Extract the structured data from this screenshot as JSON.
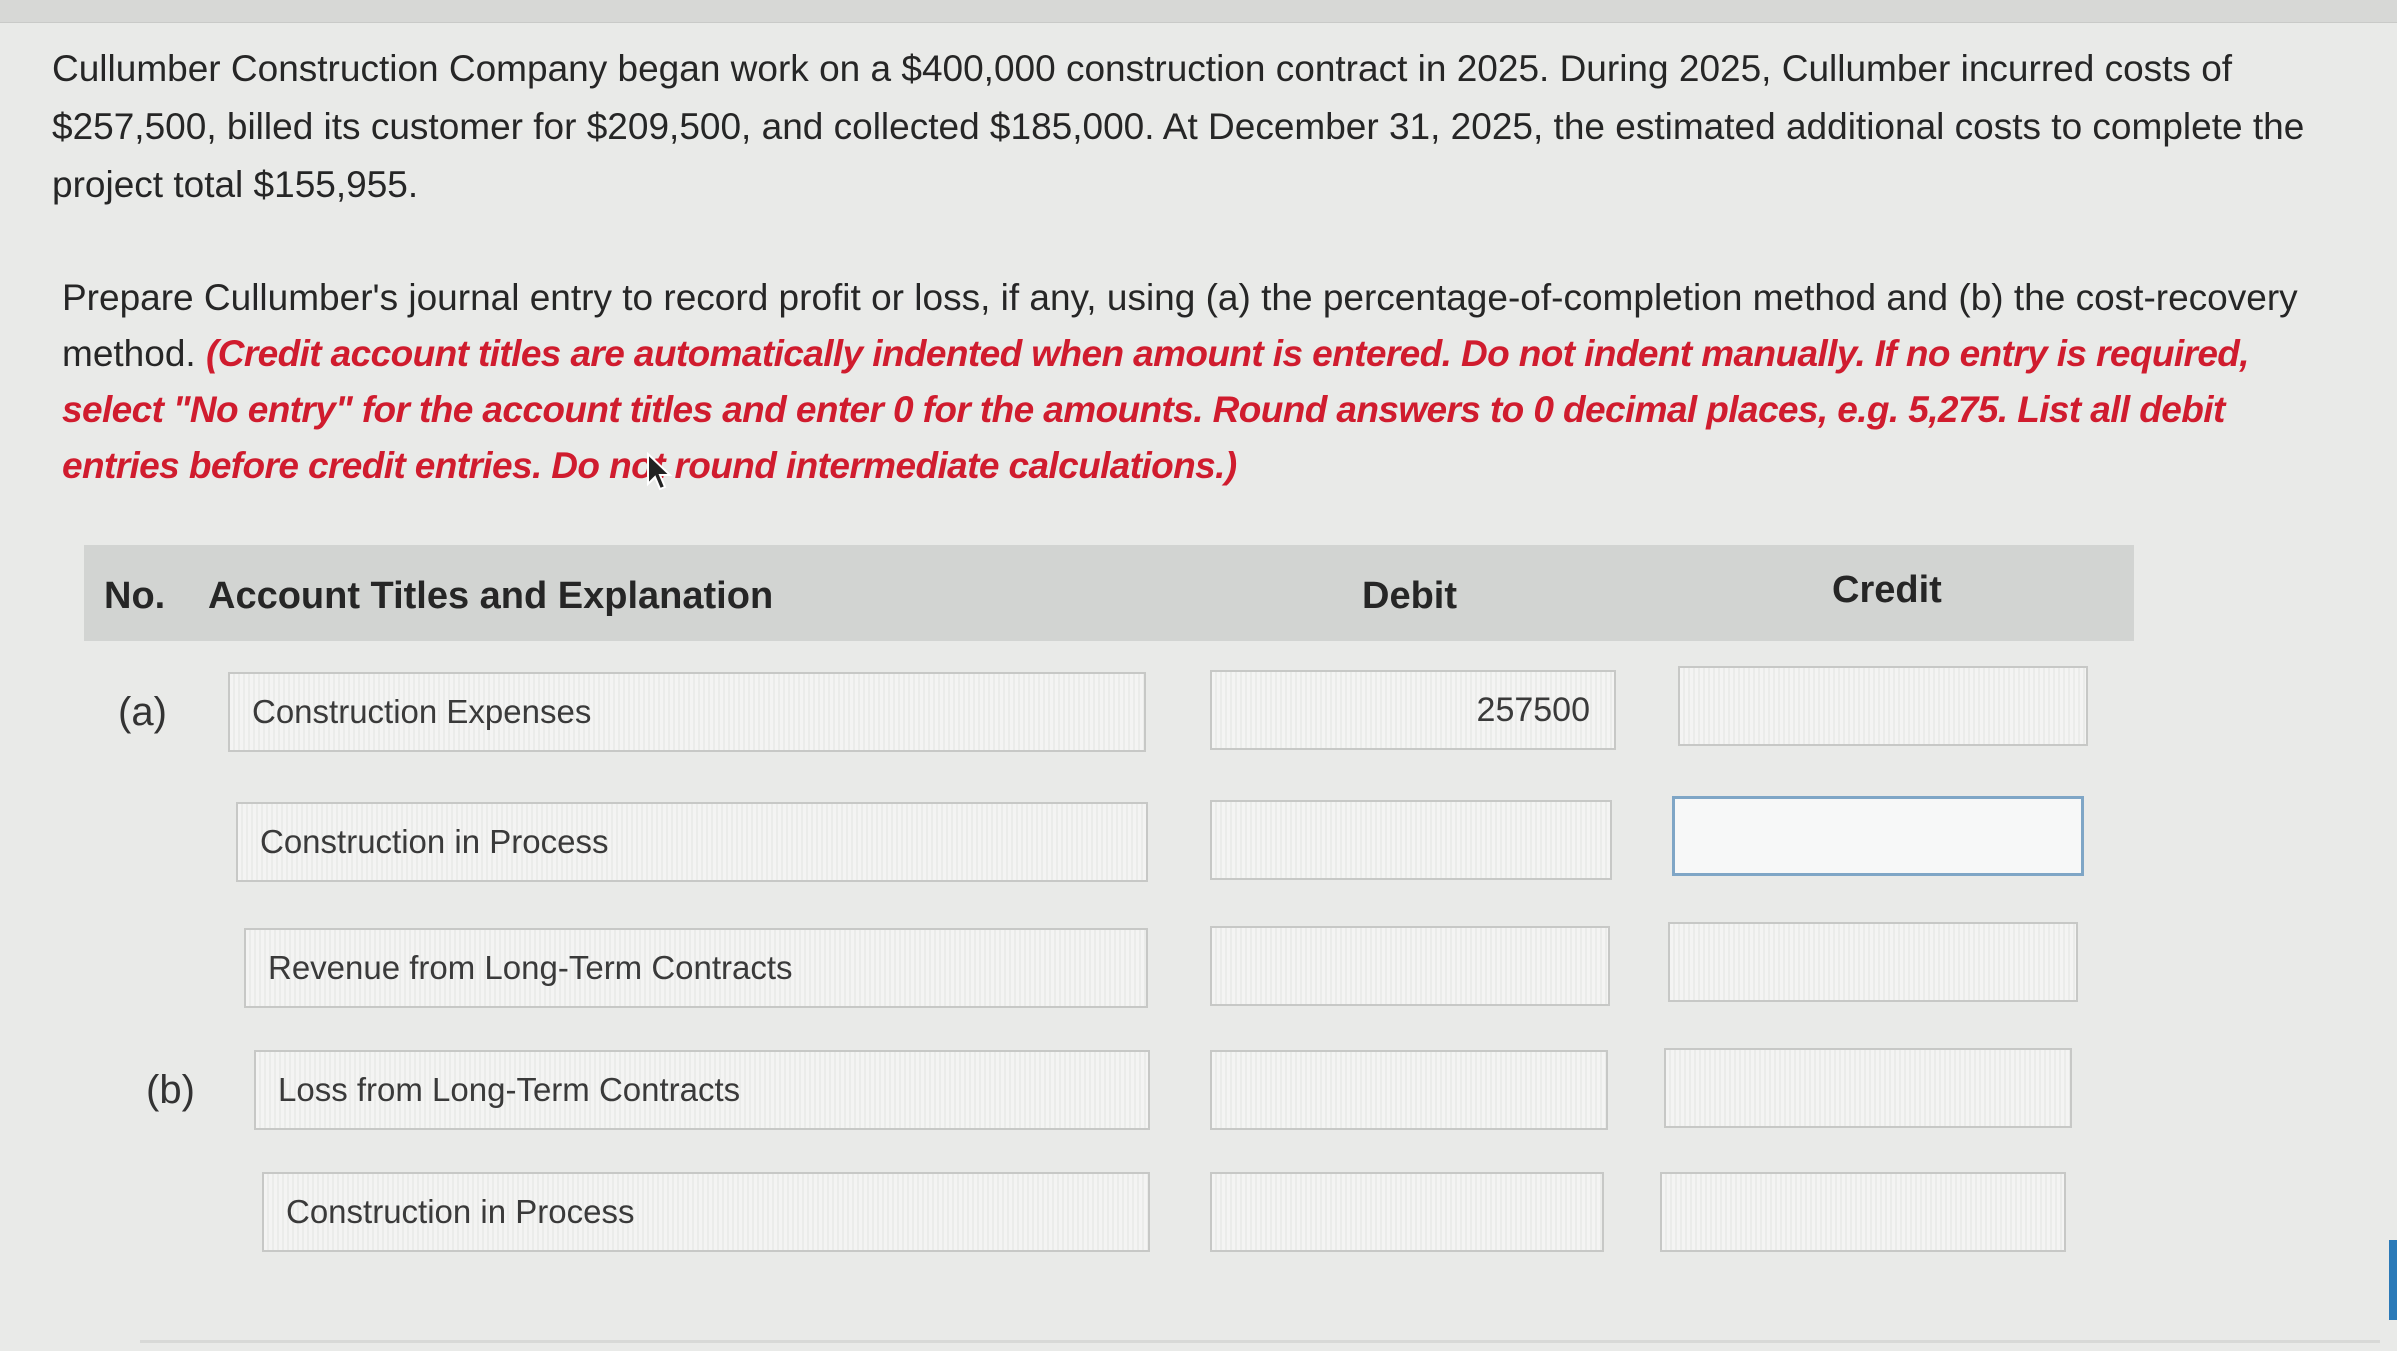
{
  "problem": {
    "paragraph": "Cullumber Construction Company began work on a $400,000 construction contract in 2025. During 2025, Cullumber incurred costs of $257,500, billed its customer for $209,500, and collected $185,000. At December 31, 2025, the estimated additional costs to complete the project total $155,955."
  },
  "instructions": {
    "main": "Prepare Cullumber's journal entry to record profit or loss, if any, using (a) the percentage-of-completion method and (b) the cost-recovery method.",
    "note": "(Credit account titles are automatically indented when amount is entered. Do not indent manually. If no entry is required, select \"No entry\" for the account titles and enter 0 for the amounts. Round answers to 0 decimal places, e.g. 5,275. List all debit entries before credit entries. Do not round intermediate calculations.)"
  },
  "table": {
    "headers": {
      "no": "No.",
      "account": "Account Titles and Explanation",
      "debit": "Debit",
      "credit": "Credit"
    },
    "rows": [
      {
        "label": "(a)",
        "account": "Construction Expenses",
        "debit": "257500",
        "credit": ""
      },
      {
        "label": "",
        "account": "Construction in Process",
        "debit": "",
        "credit": ""
      },
      {
        "label": "",
        "account": "Revenue from Long-Term Contracts",
        "debit": "",
        "credit": ""
      },
      {
        "label": "(b)",
        "account": "Loss from Long-Term Contracts",
        "debit": "",
        "credit": ""
      },
      {
        "label": "",
        "account": "Construction in Process",
        "debit": "",
        "credit": ""
      }
    ]
  },
  "colors": {
    "instruction_red": "#d01c2e",
    "header_bg": "#d2d4d2",
    "focus_border": "#7fa6c6"
  },
  "icons": {
    "cursor": "mouse-pointer-icon"
  }
}
